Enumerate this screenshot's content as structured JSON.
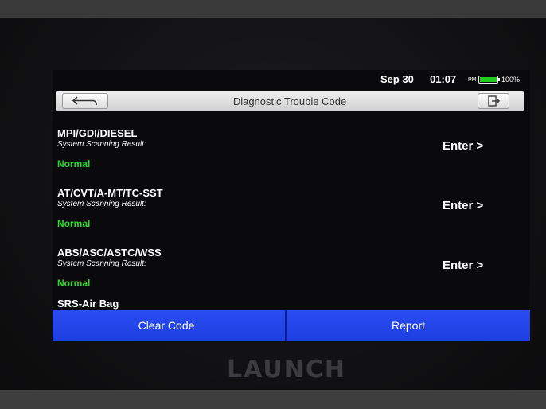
{
  "status_bar": {
    "date": "Sep 30",
    "time": "01:07",
    "ampm": "PM",
    "battery_percent": "100%",
    "battery_level": 1.0,
    "battery_color": "#22cc22"
  },
  "header": {
    "title": "Diagnostic Trouble Code",
    "back_icon": "back-arrow-icon",
    "exit_icon": "exit-door-icon"
  },
  "systems": [
    {
      "name": "MPI/GDI/DIESEL",
      "result_label": "System Scanning Result:",
      "status": "Normal",
      "enter_label": "Enter >"
    },
    {
      "name": "AT/CVT/A-MT/TC-SST",
      "result_label": "System Scanning Result:",
      "status": "Normal",
      "enter_label": "Enter >"
    },
    {
      "name": "ABS/ASC/ASTC/WSS",
      "result_label": "System Scanning Result:",
      "status": "Normal",
      "enter_label": "Enter >"
    },
    {
      "name": "SRS-Air Bag"
    }
  ],
  "footer": {
    "clear_code_label": "Clear Code",
    "report_label": "Report",
    "button_color": "#1e3fe0"
  },
  "brand": {
    "name": "LAUNCH"
  },
  "colors": {
    "normal_status": "#22dd22"
  }
}
